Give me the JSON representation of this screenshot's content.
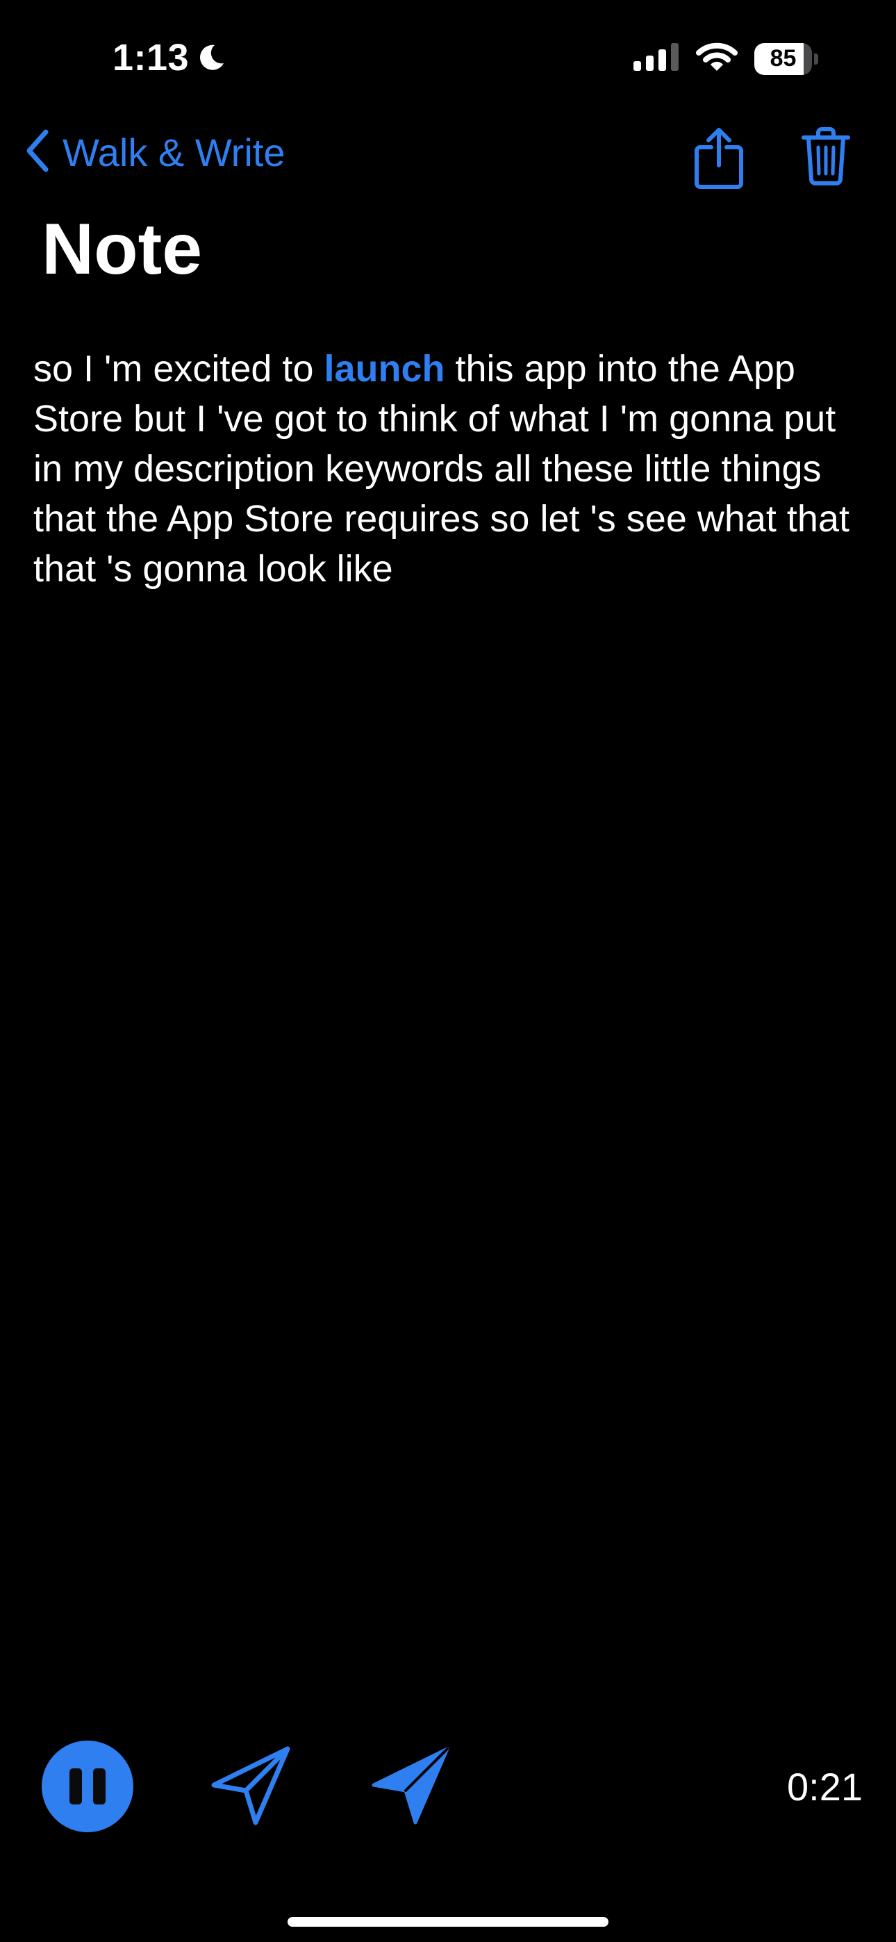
{
  "status_bar": {
    "time": "1:13",
    "focus_icon": "moon-icon",
    "signal_icon": "cellular-signal-icon",
    "wifi_icon": "wifi-icon",
    "battery_level": "85",
    "battery_fraction": 0.85
  },
  "nav": {
    "back_label": "Walk & Write",
    "back_icon": "chevron-left-icon",
    "share_icon": "share-icon",
    "trash_icon": "trash-icon"
  },
  "page": {
    "title": "Note"
  },
  "note": {
    "text_before": "so I 'm excited to ",
    "highlight": "launch",
    "text_after": " this app into the App Store but I 've got to think of what I 'm gonna put in my description keywords all these little things that the App Store requires so let 's see what that that 's gonna look like"
  },
  "controls": {
    "pause_icon": "pause-icon",
    "send_outline_icon": "send-outline-icon",
    "send_filled_icon": "send-filled-icon",
    "timer": "0:21"
  },
  "colors": {
    "accent": "#2f7ff0",
    "background": "#000000",
    "text": "#ffffff"
  }
}
